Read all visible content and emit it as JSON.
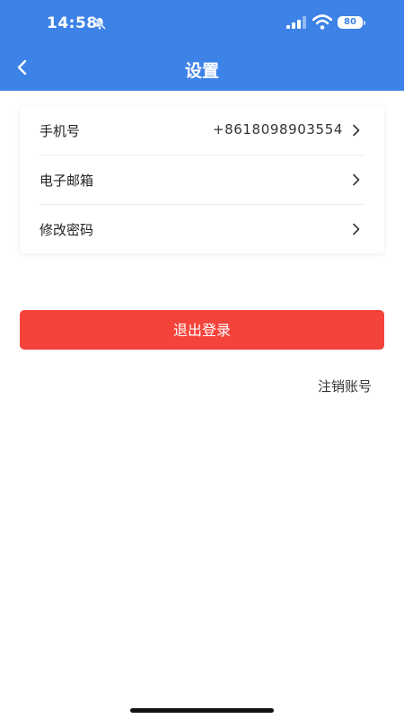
{
  "status_bar": {
    "time": "14:58",
    "battery": "80",
    "icons": [
      "bell-slash-icon",
      "signal-icon",
      "wifi-icon",
      "battery-icon"
    ]
  },
  "header": {
    "title": "设置",
    "back_icon": "chevron-left-icon",
    "background": "#3d82e6"
  },
  "settings": {
    "phone_label": "手机号",
    "phone_value": "+8618098903554",
    "email_label": "电子邮箱",
    "password_label": "修改密码",
    "chevron_icon": "chevron-right-icon"
  },
  "actions": {
    "logout_label": "退出登录",
    "logout_color": "#f4433a",
    "cancel_account_label": "注销账号"
  }
}
